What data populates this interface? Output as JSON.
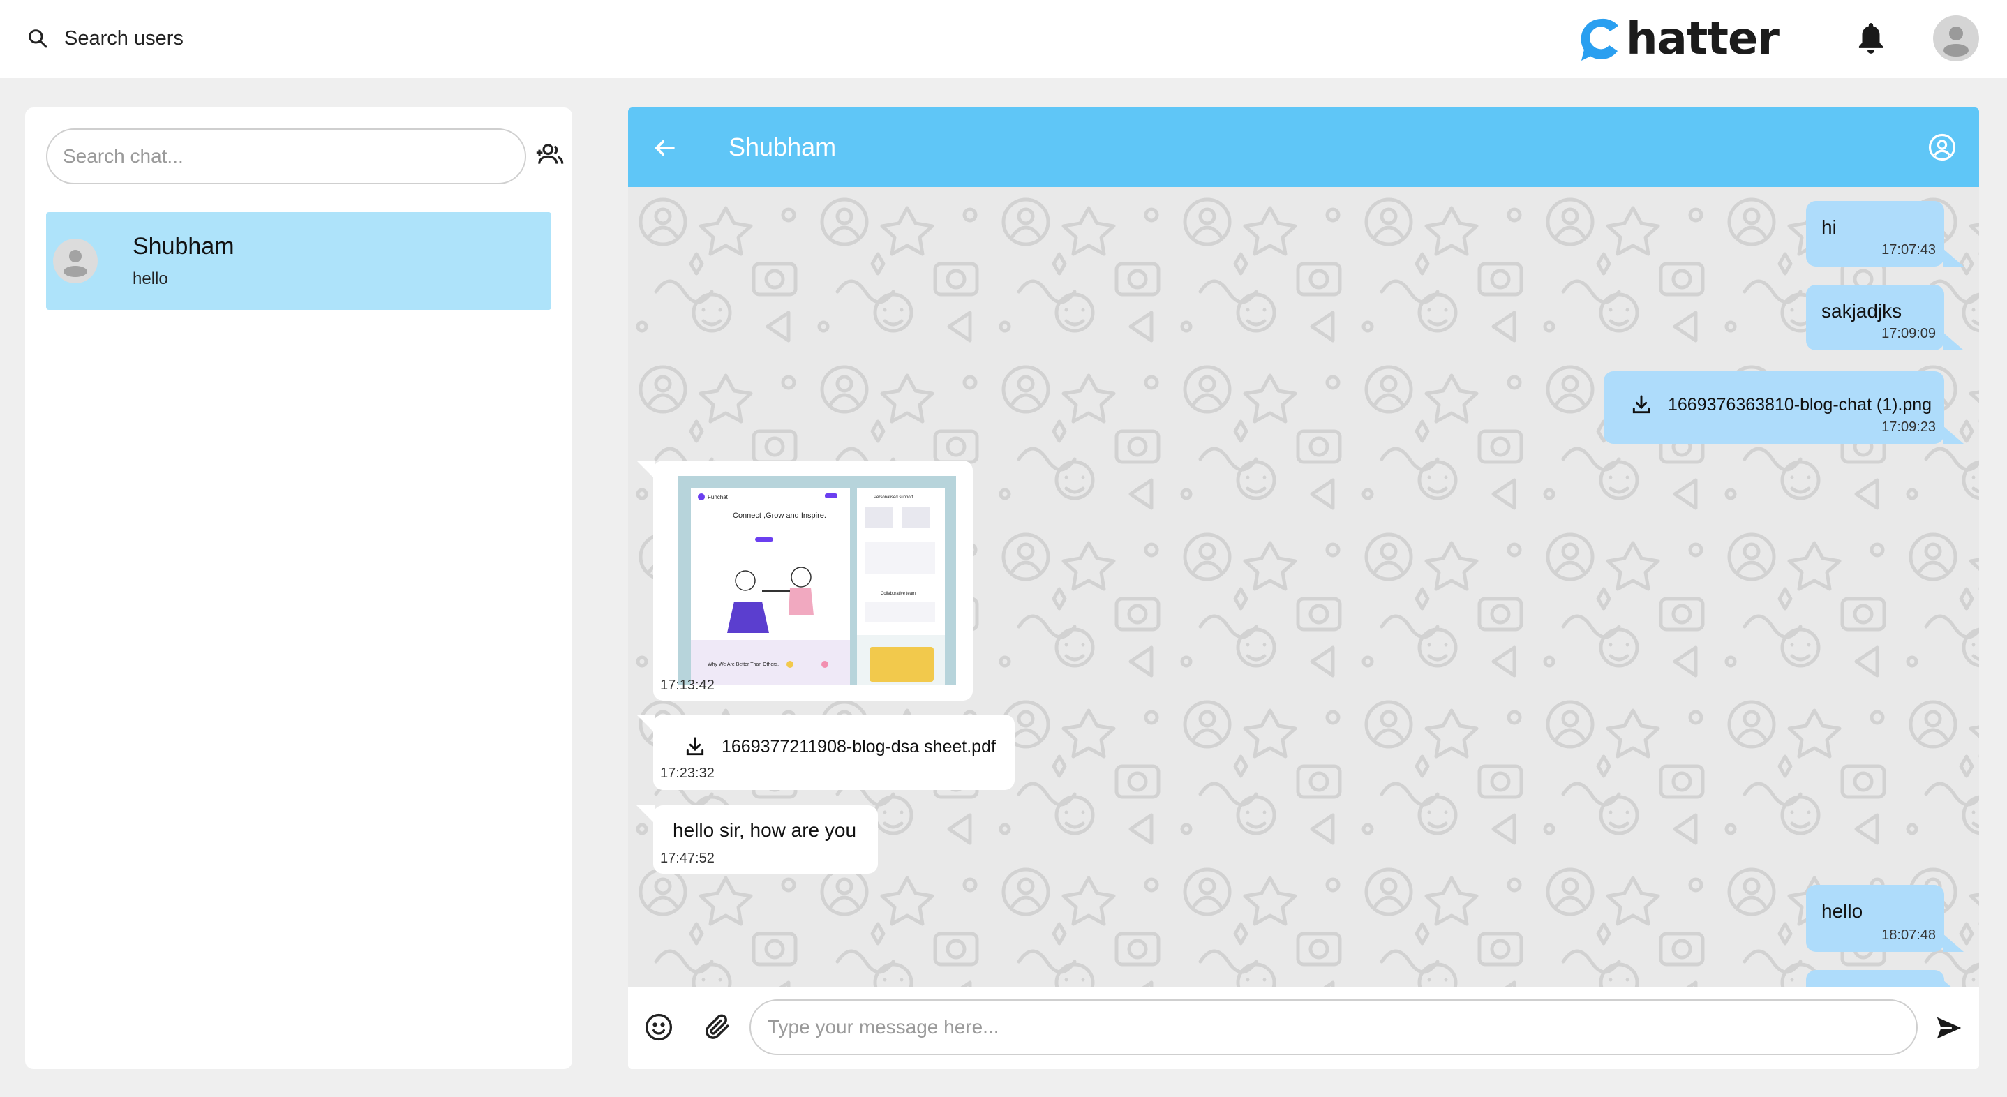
{
  "topbar": {
    "search_users_label": "Search users",
    "logo_text": "hatter",
    "logo_letter": "C",
    "icons": [
      "search-icon",
      "bell-icon",
      "avatar"
    ]
  },
  "sidebar": {
    "search_placeholder": "Search chat...",
    "add_group_icon": "add-group-icon",
    "chats": [
      {
        "name": "Shubham",
        "last_message": "hello"
      }
    ]
  },
  "chat": {
    "title": "Shubham",
    "messages": [
      {
        "direction": "out",
        "type": "text",
        "text": "hi",
        "time": "17:07:43"
      },
      {
        "direction": "out",
        "type": "text",
        "text": "sakjadjks",
        "time": "17:09:09"
      },
      {
        "direction": "out",
        "type": "file",
        "text": "1669376363810-blog-chat (1).png",
        "time": "17:09:23"
      },
      {
        "direction": "in",
        "type": "image",
        "time": "17:13:42",
        "image_text": {
          "heading": "Connect ,Grow and Inspire.",
          "footer": "Why We Are Better Than Others.",
          "side_title": "Personalised support",
          "side_section": "Collaborative team",
          "brand": "Funchat"
        }
      },
      {
        "direction": "in",
        "type": "file",
        "text": "1669377211908-blog-dsa sheet.pdf",
        "time": "17:23:32"
      },
      {
        "direction": "in",
        "type": "text",
        "text": "hello sir, how are you",
        "time": "17:47:52"
      },
      {
        "direction": "out",
        "type": "text",
        "text": "hello",
        "time": "18:07:48"
      }
    ]
  },
  "composer": {
    "placeholder": "Type your message here..."
  },
  "colors": {
    "header_blue": "#5fc6f7",
    "outgoing_bubble": "#aedcfb",
    "active_chat": "#aee3fa",
    "logo_blue": "#2a9ff0"
  }
}
